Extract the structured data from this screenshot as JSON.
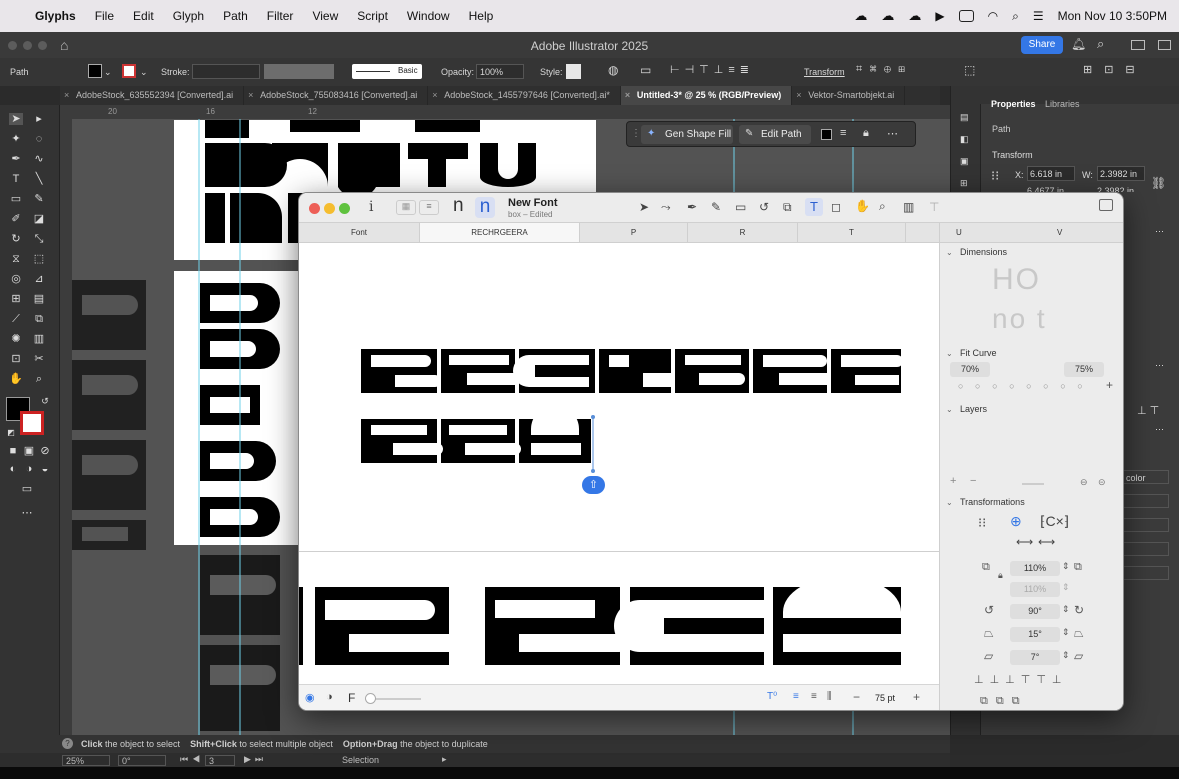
{
  "menubar": {
    "app": "Glyphs",
    "items": [
      "File",
      "Edit",
      "Glyph",
      "Path",
      "Filter",
      "View",
      "Script",
      "Window",
      "Help"
    ],
    "datetime": "Mon Nov 10  3:50PM"
  },
  "illustrator": {
    "title": "Adobe Illustrator 2025",
    "share_label": "Share",
    "control": {
      "object_type": "Path",
      "stroke_label": "Stroke:",
      "brush_label": "Basic",
      "opacity_label": "Opacity:",
      "opacity_value": "100%",
      "style_label": "Style:",
      "transform_label": "Transform"
    },
    "tabs": [
      {
        "label": "AdobeStock_635552394 [Converted].ai"
      },
      {
        "label": "AdobeStock_755083416 [Converted].ai"
      },
      {
        "label": "AdobeStock_1455797646 [Converted].ai*"
      },
      {
        "label": "Untitled-3* @ 25 % (RGB/Preview)"
      },
      {
        "label": "Vektor-Smartobjekt.ai"
      }
    ],
    "ruler_ticks": [
      "20",
      "16",
      "12"
    ],
    "context_bar": {
      "gen_shape_fill": "Gen Shape Fill",
      "edit_path": "Edit Path"
    },
    "properties": {
      "tab_properties": "Properties",
      "tab_libraries": "Libraries",
      "object_type": "Path",
      "section_transform": "Transform",
      "x_label": "X:",
      "x_value": "6.618 in",
      "w_label": "W:",
      "w_value": "2.3982 in",
      "y_value_partial": "6.4677 in",
      "h_value_partial": "2.3982 in",
      "color_label": "color"
    },
    "status_hint": {
      "a_bold": "Click",
      "a_text": " the object to select",
      "b_bold": "Shift+Click",
      "b_text": " to select multiple object",
      "c_bold": "Option+Drag",
      "c_text": " the object to duplicate"
    },
    "bottom": {
      "zoom": "25%",
      "rotation": "0°",
      "artboard": "3",
      "mode": "Selection"
    }
  },
  "glyphs_window": {
    "title": "New Font",
    "subtitle": "box – Edited",
    "tabs": [
      {
        "label": "Font"
      },
      {
        "label": "RECHRGEERA"
      },
      {
        "label": "P"
      },
      {
        "label": "R"
      },
      {
        "label": "T"
      },
      {
        "label": "U"
      },
      {
        "label": "V"
      }
    ],
    "sidebar": {
      "dimensions": "Dimensions",
      "fit_curve": "Fit Curve",
      "fit_left": "70%",
      "fit_right": "75%",
      "layers": "Layers",
      "transformations": "Transformations",
      "scale_x": "110%",
      "scale_y": "110%",
      "rotate": "90°",
      "slant": "15°",
      "skew": "7°"
    },
    "bottom": {
      "font_size": "75 pt",
      "f_label": "F"
    }
  },
  "colors": {
    "accent_blue": "#3477e6",
    "ai_panel": "#3b3b3b",
    "canvas_gray": "#535353"
  }
}
